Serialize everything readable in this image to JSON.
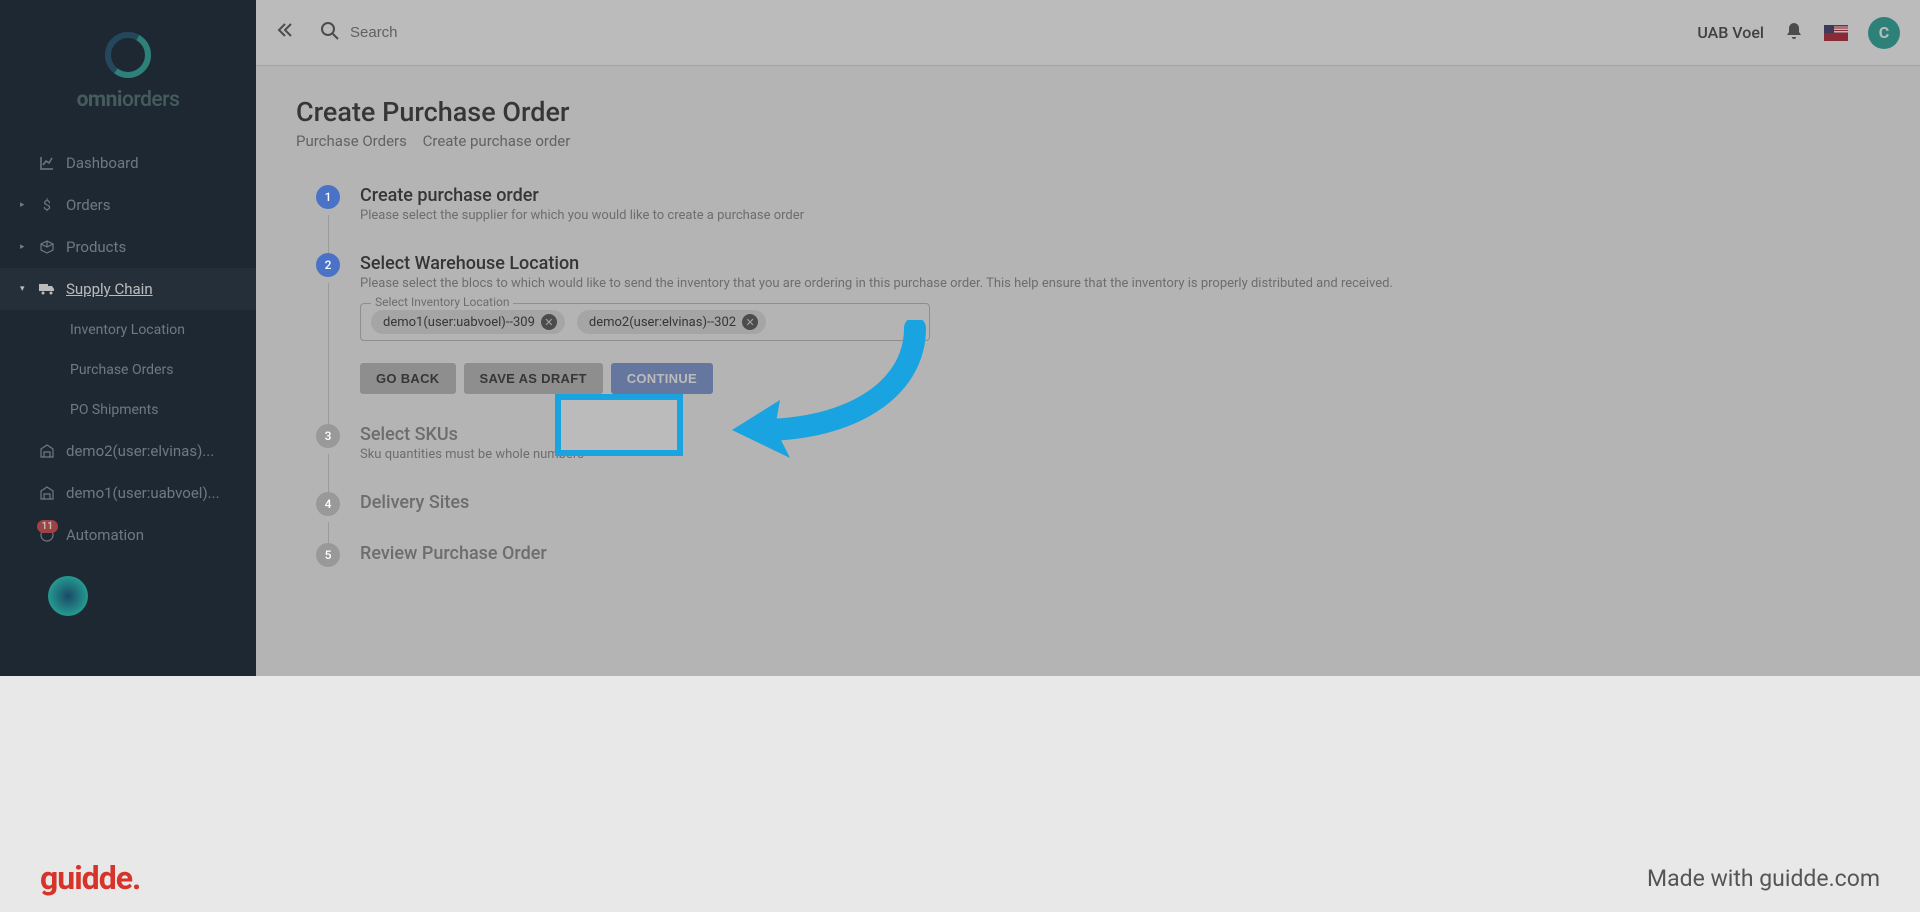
{
  "brand": {
    "name_part1": "omni",
    "name_part2": "orders"
  },
  "sidebar": {
    "items": [
      {
        "label": "Dashboard",
        "icon": "chart"
      },
      {
        "label": "Orders",
        "icon": "dollar"
      },
      {
        "label": "Products",
        "icon": "box"
      },
      {
        "label": "Supply Chain",
        "icon": "truck"
      },
      {
        "label": "Inventory Location"
      },
      {
        "label": "Purchase Orders"
      },
      {
        "label": "PO Shipments"
      },
      {
        "label": "demo2(user:elvinas)...",
        "icon": "warehouse"
      },
      {
        "label": "demo1(user:uabvoel)...",
        "icon": "warehouse"
      },
      {
        "label": "Automation",
        "badge": "11"
      }
    ]
  },
  "header": {
    "search_placeholder": "Search",
    "org_name": "UAB Voel",
    "avatar_initial": "C"
  },
  "page": {
    "title": "Create Purchase Order",
    "breadcrumb": [
      "Purchase Orders",
      "Create purchase order"
    ]
  },
  "steps": [
    {
      "num": "1",
      "title": "Create purchase order",
      "desc": "Please select the supplier for which you would like to create a purchase order",
      "active": true
    },
    {
      "num": "2",
      "title": "Select Warehouse Location",
      "desc": "Please select the blocs to which would like to send the inventory that you are ordering in this purchase order. This help ensure that the inventory is properly distributed and received.",
      "active": true
    },
    {
      "num": "3",
      "title": "Select SKUs",
      "desc": "Sku quantities must be whole numbers",
      "active": false
    },
    {
      "num": "4",
      "title": "Delivery Sites",
      "desc": "",
      "active": false
    },
    {
      "num": "5",
      "title": "Review Purchase Order",
      "desc": "",
      "active": false
    }
  ],
  "chip_field": {
    "label": "Select Inventory Location",
    "chips": [
      "demo1(user:uabvoel)--309",
      "demo2(user:elvinas)--302"
    ]
  },
  "buttons": {
    "back": "GO BACK",
    "draft": "SAVE AS DRAFT",
    "continue": "CONTINUE"
  },
  "footer": {
    "logo": "guidde",
    "text": "Made with guidde.com"
  }
}
